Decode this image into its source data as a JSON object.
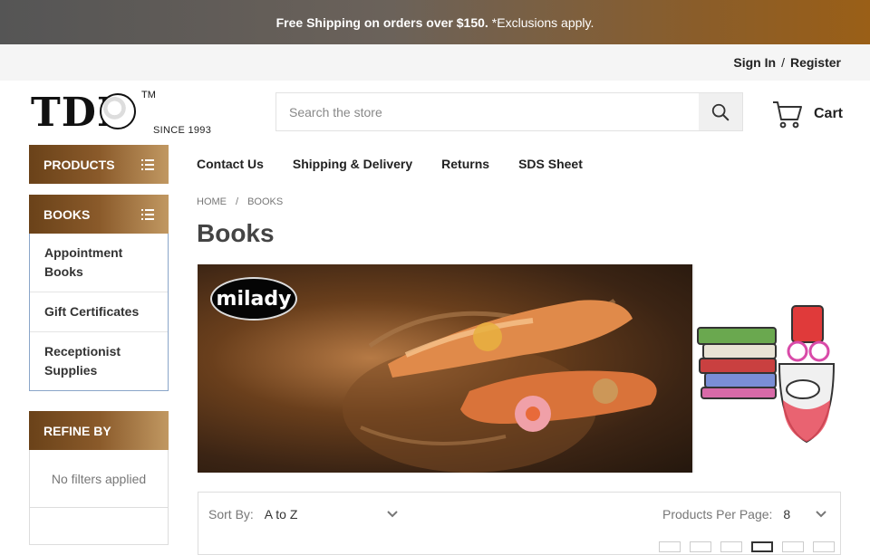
{
  "promo": {
    "bold": "Free Shipping on orders over $150.",
    "note": "*Exclusions apply."
  },
  "account": {
    "sign_in": "Sign In",
    "separator": "/",
    "register": "Register"
  },
  "logo": {
    "text": "TDI",
    "tm": "TM",
    "since": "SINCE 1993"
  },
  "search": {
    "placeholder": "Search the store",
    "icon": "search-icon"
  },
  "cart": {
    "label": "Cart",
    "icon": "cart-icon"
  },
  "sidebar": {
    "products_label": "PRODUCTS",
    "books_label": "BOOKS",
    "categories": [
      {
        "label": "Appointment Books"
      },
      {
        "label": "Gift Certificates"
      },
      {
        "label": "Receptionist Supplies"
      }
    ],
    "refine_label": "REFINE BY",
    "no_filters": "No filters applied"
  },
  "nav": [
    {
      "label": "Contact Us"
    },
    {
      "label": "Shipping & Delivery"
    },
    {
      "label": "Returns"
    },
    {
      "label": "SDS Sheet"
    }
  ],
  "breadcrumb": {
    "home": "HOME",
    "separator": "/",
    "current": "BOOKS"
  },
  "page_title": "Books",
  "banner": {
    "brand": "milady"
  },
  "toolbar": {
    "sort_label": "Sort By:",
    "sort_value": "A to Z",
    "per_page_label": "Products Per Page:",
    "per_page_value": "8"
  },
  "colors": {
    "accent_brown": "#8a5a2a",
    "promo_end": "#9a5f17"
  }
}
